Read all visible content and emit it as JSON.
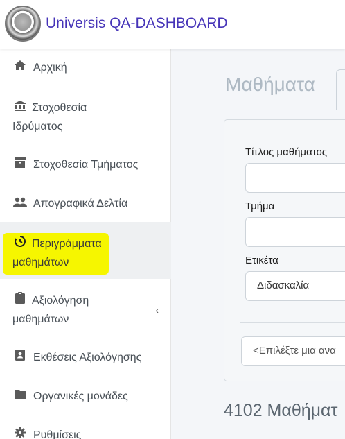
{
  "app": {
    "title": "Universis QA-DASHBOARD"
  },
  "sidebar": {
    "items": [
      {
        "icon": "home-icon",
        "label": "Αρχική"
      },
      {
        "icon": "institution-icon",
        "label_line1": "Στοχοθεσία",
        "label_line2": "Ιδρύματος"
      },
      {
        "icon": "archive-icon",
        "label": "Στοχοθεσία Τμήματος"
      },
      {
        "icon": "users-icon",
        "label": "Απογραφικά Δελτία"
      },
      {
        "icon": "history-icon",
        "label_line1": "Περιγράμματα",
        "label_line2": "μαθημάτων",
        "active": true
      },
      {
        "icon": "clipboard-icon",
        "label_line1": "Αξιολόγηση",
        "label_line2": "μαθημάτων",
        "chevron": "‹"
      },
      {
        "icon": "address-book-icon",
        "label": "Εκθέσεις Αξιολόγησης"
      },
      {
        "icon": "folder-icon",
        "label": "Οργανικές μονάδες"
      },
      {
        "icon": "gear-icon",
        "label": "Ρυθμίσεις"
      }
    ]
  },
  "main": {
    "title": "Μαθήματα",
    "filters": {
      "course_title_label": "Τίτλος μαθήματος",
      "course_title_value": "",
      "department_label": "Τμήμα",
      "department_value": "",
      "tag_label": "Ετικέτα",
      "tag_value": "Διδασκαλία",
      "select_text": "<Επιλέξτε μια ανα"
    },
    "count_text": "4102 Μαθήματ"
  }
}
